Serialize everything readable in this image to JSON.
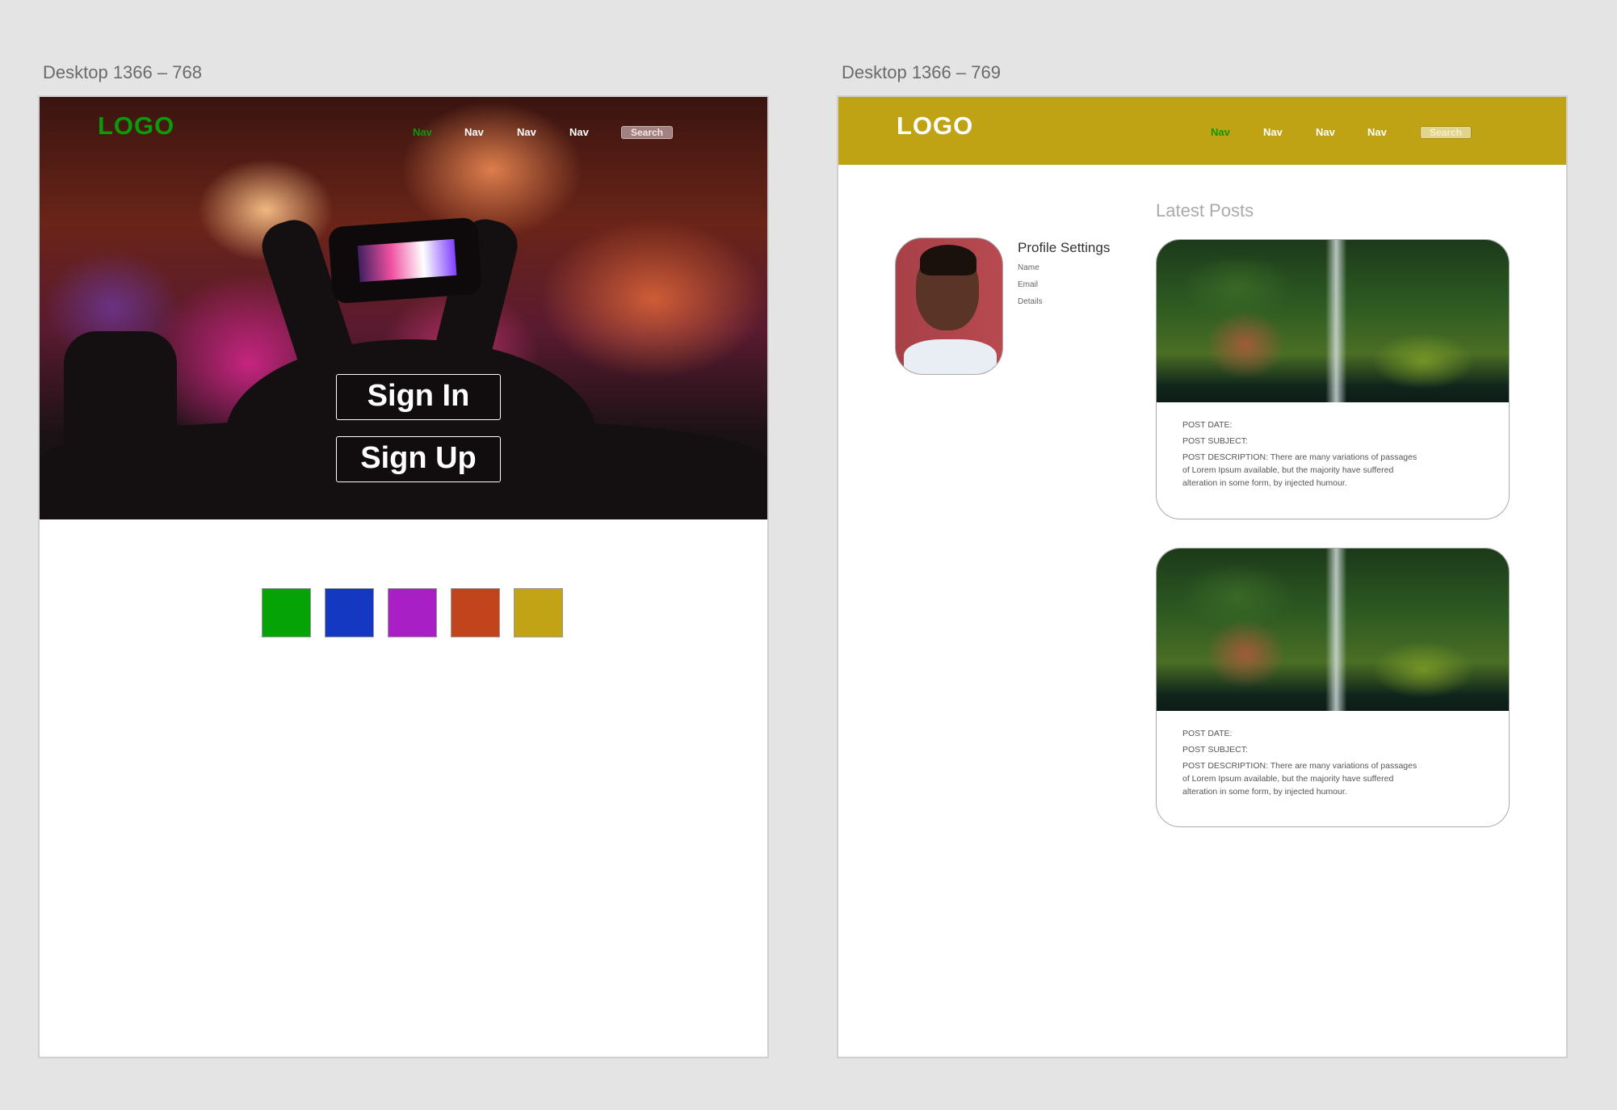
{
  "artboards": [
    {
      "label": "Desktop 1366 – 768",
      "logo": "LOGO",
      "nav": [
        "Nav",
        "Nav",
        "Nav",
        "Nav"
      ],
      "search_placeholder": "Search",
      "sign_in": "Sign In",
      "sign_up": "Sign Up",
      "swatches": [
        "#06a306",
        "#1438c2",
        "#a81fc6",
        "#c1441c",
        "#c1a315"
      ]
    },
    {
      "label": "Desktop 1366 – 769",
      "logo": "LOGO",
      "nav": [
        "Nav",
        "Nav",
        "Nav",
        "Nav"
      ],
      "search_placeholder": "Search",
      "header_color": "#bfa314",
      "latest_posts": "Latest Posts",
      "profile": {
        "title": "Profile Settings",
        "items": [
          "Name",
          "Email",
          "Details"
        ]
      },
      "posts": [
        {
          "date": "POST DATE:",
          "subject": "POST SUBJECT:",
          "description": "POST DESCRIPTION: There are many variations of passages of Lorem Ipsum available, but the majority have suffered alteration in some form, by injected humour."
        },
        {
          "date": "POST DATE:",
          "subject": "POST SUBJECT:",
          "description": "POST DESCRIPTION: There are many variations of passages of Lorem Ipsum available, but the majority have suffered alteration in some form, by injected humour."
        }
      ]
    }
  ]
}
